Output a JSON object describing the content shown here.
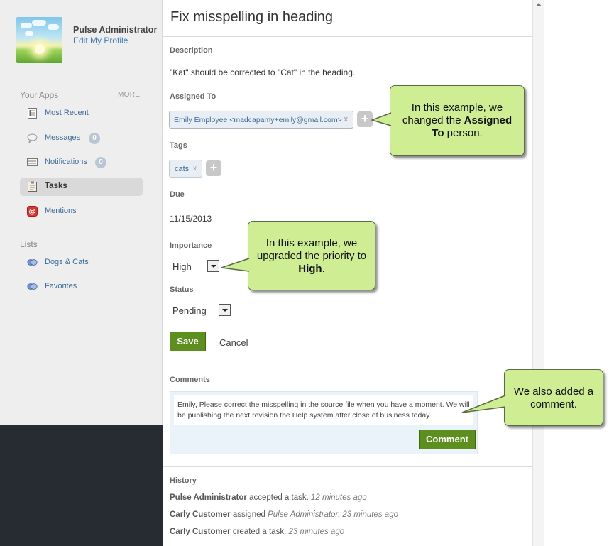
{
  "profile": {
    "name": "Pulse Administrator",
    "edit_link": "Edit My Profile"
  },
  "sidebar": {
    "apps_heading": "Your Apps",
    "more": "MORE",
    "apps": [
      {
        "label": "Most Recent",
        "icon": "recent-icon"
      },
      {
        "label": "Messages",
        "icon": "messages-icon",
        "badge": "0"
      },
      {
        "label": "Notifications",
        "icon": "notifications-icon",
        "badge": "0"
      },
      {
        "label": "Tasks",
        "icon": "tasks-icon",
        "active": true
      },
      {
        "label": "Mentions",
        "icon": "mentions-icon"
      }
    ],
    "lists_heading": "Lists",
    "lists": [
      {
        "label": "Dogs & Cats",
        "icon": "list-icon"
      },
      {
        "label": "Favorites",
        "icon": "list-icon"
      }
    ]
  },
  "task": {
    "title": "Fix misspelling in heading",
    "description_label": "Description",
    "description": "\"Kat\" should be corrected to \"Cat\" in the heading.",
    "assigned_label": "Assigned To",
    "assignee": "Emily Employee <madcapamy+emily@gmail.com>",
    "tags_label": "Tags",
    "tags": [
      "cats"
    ],
    "due_label": "Due",
    "due": "11/15/2013",
    "importance_label": "Importance",
    "importance": "High",
    "status_label": "Status",
    "status": "Pending",
    "save_label": "Save",
    "cancel_label": "Cancel",
    "remove_glyph": "x",
    "plus_glyph": "+"
  },
  "comments": {
    "label": "Comments",
    "text": "Emily, Please correct the misspelling in the source file when you have a moment.  We will be publishing the next revision the Help system after close of business today.",
    "button": "Comment"
  },
  "history": {
    "label": "History",
    "entries": [
      {
        "actor": "Pulse Administrator",
        "action": "accepted a task.",
        "object": "",
        "time": "12 minutes ago"
      },
      {
        "actor": "Carly Customer",
        "action": "assigned",
        "object": "Pulse Administrator.",
        "time": "23 minutes ago"
      },
      {
        "actor": "Carly Customer",
        "action": "created a task.",
        "object": "",
        "time": "23 minutes ago"
      }
    ]
  },
  "callouts": {
    "assigned": {
      "pre": "In this example, we changed the ",
      "bold": "Assigned To",
      "post": " person."
    },
    "importance": {
      "pre": "In this example, we upgraded the priority to ",
      "bold": "High",
      "post": "."
    },
    "comment": {
      "text": "We also added a comment."
    }
  },
  "colors": {
    "callout_fill": "#cfee93",
    "button_green": "#5d8f1f",
    "link_blue": "#3d7cb8",
    "sidebar_bg": "#eeeeee"
  }
}
